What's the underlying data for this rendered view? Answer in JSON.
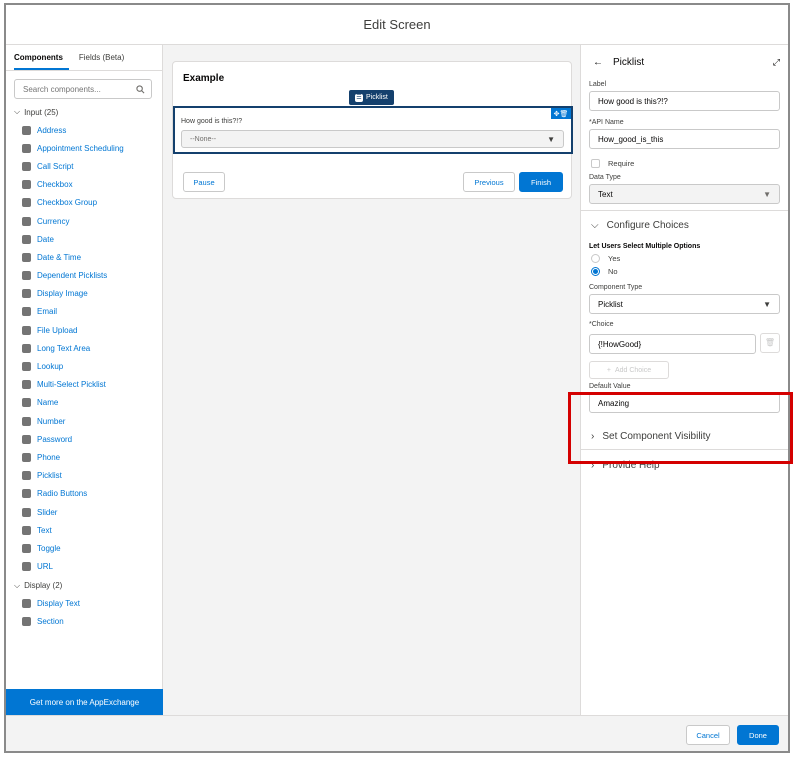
{
  "header": {
    "title": "Edit Screen"
  },
  "left": {
    "tabs": [
      {
        "label": "Components"
      },
      {
        "label": "Fields (Beta)"
      }
    ],
    "search": {
      "placeholder": "Search components..."
    },
    "input_group": {
      "label": "Input (25)",
      "items": [
        "Address",
        "Appointment Scheduling",
        "Call Script",
        "Checkbox",
        "Checkbox Group",
        "Currency",
        "Date",
        "Date & Time",
        "Dependent Picklists",
        "Display Image",
        "Email",
        "File Upload",
        "Long Text Area",
        "Lookup",
        "Multi-Select Picklist",
        "Name",
        "Number",
        "Password",
        "Phone",
        "Picklist",
        "Radio Buttons",
        "Slider",
        "Text",
        "Toggle",
        "URL"
      ]
    },
    "display_group": {
      "label": "Display (2)",
      "items": [
        "Display Text",
        "Section"
      ]
    },
    "appexchange": "Get more on the AppExchange"
  },
  "canvas": {
    "title": "Example",
    "badge": "Picklist",
    "question": "How good is this?!?",
    "placeholder": "--None--",
    "pause": "Pause",
    "previous": "Previous",
    "finish": "Finish"
  },
  "props": {
    "title": "Picklist",
    "label_label": "Label",
    "label_value": "How good is this?!?",
    "api_label": "*API Name",
    "api_value": "How_good_is_this",
    "require": "Require",
    "datatype_label": "Data Type",
    "datatype_value": "Text",
    "configure": "Configure Choices",
    "multi_label": "Let Users Select Multiple Options",
    "yes": "Yes",
    "no": "No",
    "comptype_label": "Component Type",
    "comptype_value": "Picklist",
    "choice_label": "*Choice",
    "choice_value": "{!HowGood}",
    "add_choice": "Add Choice",
    "default_label": "Default Value",
    "default_value": "Amazing",
    "visibility": "Set Component Visibility",
    "help": "Provide Help"
  },
  "footer": {
    "cancel": "Cancel",
    "done": "Done"
  }
}
